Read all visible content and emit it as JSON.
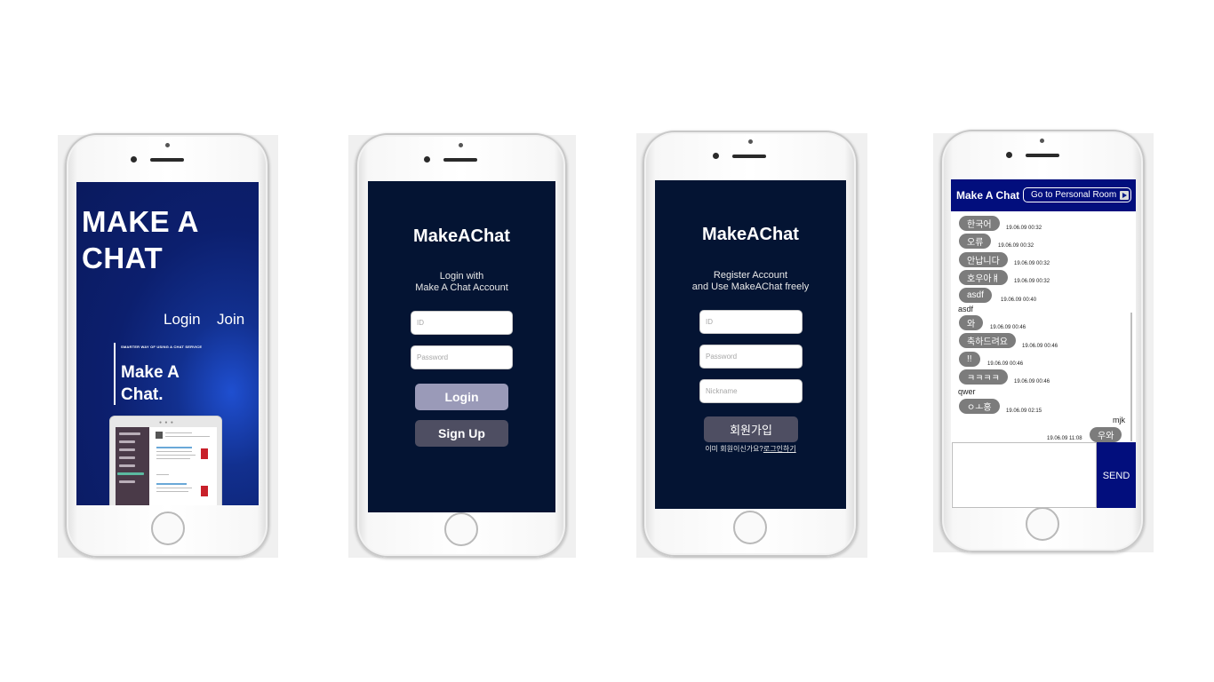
{
  "screen1": {
    "brand_line1": "MAKE A",
    "brand_line2": "CHAT",
    "nav_login": "Login",
    "nav_join": "Join",
    "tagline_small": "SMARTER WAY OF USING A CHAT SERVICE",
    "tagline_line1": "Make A",
    "tagline_line2": "Chat."
  },
  "screen2": {
    "title": "MakeAChat",
    "subtitle_line1": "Login with",
    "subtitle_line2": "Make A Chat Account",
    "id_placeholder": "ID",
    "password_placeholder": "Password",
    "login_label": "Login",
    "signup_label": "Sign Up",
    "colors": {
      "background": "#041433",
      "login_button": "#9a9ab8",
      "signup_button": "#4e4e62"
    }
  },
  "screen3": {
    "title": "MakeAChat",
    "subtitle_line1": "Register Account",
    "subtitle_line2": "and Use MakeAChat freely",
    "id_placeholder": "ID",
    "password_placeholder": "Password",
    "nickname_placeholder": "Nickname",
    "register_label": "회원가입",
    "already_text": "이미 회원이신가요?",
    "login_link": "로그인하기"
  },
  "screen4": {
    "header_title": "Make A Chat",
    "personal_room_button": "Go to Personal Room",
    "send_label": "SEND",
    "accent_color": "#020e7d",
    "messages": [
      {
        "text": "한국어",
        "time": "19.06.09 00:32"
      },
      {
        "text": "오류",
        "time": "19.06.09 00:32"
      },
      {
        "text": "안납니다",
        "time": "19.06.09 00:32"
      },
      {
        "text": "호우아ㅒ",
        "time": "19.06.09 00:32"
      },
      {
        "text": "asdf",
        "time": "19.06.09 00:40"
      },
      {
        "plain": "asdf"
      },
      {
        "text": "와",
        "time": "19.06.09 00:46"
      },
      {
        "text": "축하드려요",
        "time": "19.06.09 00:46"
      },
      {
        "text": "!!",
        "time": "19.06.09 00:46"
      },
      {
        "text": "ㅋㅋㅋㅋ",
        "time": "19.06.09 00:46"
      },
      {
        "plain": "qwer"
      },
      {
        "text": "ㅇㅗ홍",
        "time": "19.06.09 02:15"
      },
      {
        "sender": "mjk",
        "text": "우와",
        "time": "19.06.09 11:08"
      }
    ]
  }
}
